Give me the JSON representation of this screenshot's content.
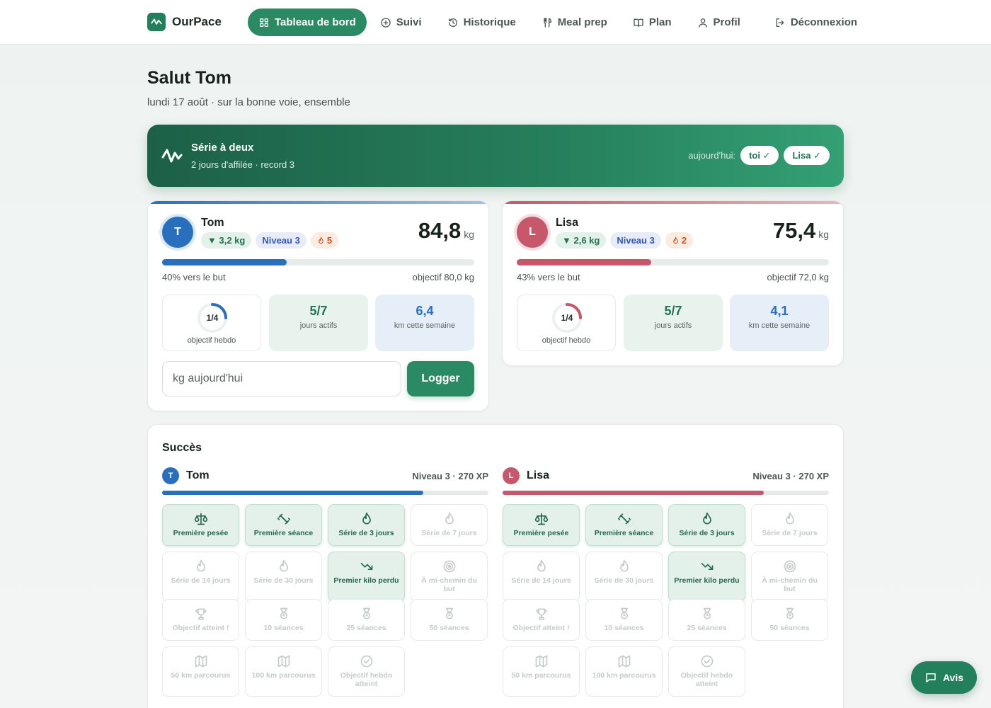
{
  "brand": {
    "name": "OurPace"
  },
  "nav": [
    {
      "label": "Tableau de bord",
      "icon": "grid-icon",
      "active": true
    },
    {
      "label": "Suivi",
      "icon": "plus-circle-icon"
    },
    {
      "label": "Historique",
      "icon": "history-icon"
    },
    {
      "label": "Meal prep",
      "icon": "utensils-icon"
    },
    {
      "label": "Plan",
      "icon": "book-icon"
    },
    {
      "label": "Profil",
      "icon": "user-icon"
    },
    {
      "label": "Déconnexion",
      "icon": "logout-icon"
    }
  ],
  "greeting": {
    "title": "Salut Tom",
    "subtitle": "lundi 17 août · sur la bonne voie, ensemble"
  },
  "streak": {
    "title": "Série à deux",
    "subtitle": "2 jours d'affilée · record 3",
    "today_label": "aujourd'hui:",
    "you": "toi ✓",
    "partner": "Lisa ✓"
  },
  "people": [
    {
      "initial": "T",
      "name": "Tom",
      "color": "#2870be",
      "loss": "▼ 3,2 kg",
      "level": "Niveau 3",
      "streak": "5",
      "weight": "84,8",
      "unit": "kg",
      "progress_pct": 40,
      "progress_label": "40% vers le but",
      "goal_label": "objectif 80,0 kg",
      "weekly_goal": "1/4",
      "weekly_goal_done": 1,
      "weekly_goal_total": 4,
      "weekly_goal_label": "objectif hebdo",
      "active_days": "5/7",
      "active_days_label": "jours actifs",
      "km": "6,4",
      "km_label": "km cette semaine",
      "level_line": "Niveau 3 · 270 XP",
      "xp_pct": 80
    },
    {
      "initial": "L",
      "name": "Lisa",
      "color": "#c7576a",
      "loss": "▼ 2,6 kg",
      "level": "Niveau 3",
      "streak": "2",
      "weight": "75,4",
      "unit": "kg",
      "progress_pct": 43,
      "progress_label": "43% vers le but",
      "goal_label": "objectif 72,0 kg",
      "weekly_goal": "1/4",
      "weekly_goal_done": 1,
      "weekly_goal_total": 4,
      "weekly_goal_label": "objectif hebdo",
      "active_days": "5/7",
      "active_days_label": "jours actifs",
      "km": "4,1",
      "km_label": "km cette semaine",
      "level_line": "Niveau 3 · 270 XP",
      "xp_pct": 80
    }
  ],
  "log": {
    "placeholder": "kg aujourd'hui",
    "button": "Logger"
  },
  "achievements": {
    "title": "Succès",
    "badges": [
      {
        "label": "Première pesée",
        "icon": "scale-icon",
        "unlocked": true
      },
      {
        "label": "Première séance",
        "icon": "dumbbell-icon",
        "unlocked": true
      },
      {
        "label": "Série de 3 jours",
        "icon": "flame-icon",
        "unlocked": true
      },
      {
        "label": "Série de 7 jours",
        "icon": "flame-icon",
        "unlocked": false
      },
      {
        "label": "Série de 14 jours",
        "icon": "flame-icon",
        "unlocked": false
      },
      {
        "label": "Série de 30 jours",
        "icon": "flame-icon",
        "unlocked": false
      },
      {
        "label": "Premier kilo perdu",
        "icon": "trend-down-icon",
        "unlocked": true
      },
      {
        "label": "À mi-chemin du but",
        "icon": "target-icon",
        "unlocked": false
      },
      {
        "label": "Objectif atteint !",
        "icon": "trophy-icon",
        "unlocked": false
      },
      {
        "label": "10 séances",
        "icon": "medal-icon",
        "unlocked": false
      },
      {
        "label": "25 séances",
        "icon": "medal-icon",
        "unlocked": false
      },
      {
        "label": "50 séances",
        "icon": "medal-icon",
        "unlocked": false
      },
      {
        "label": "50 km parcourus",
        "icon": "map-icon",
        "unlocked": false
      },
      {
        "label": "100 km parcourus",
        "icon": "map-icon",
        "unlocked": false
      },
      {
        "label": "Objectif hebdo atteint",
        "icon": "check-circle-icon",
        "unlocked": false
      }
    ]
  },
  "feedback": {
    "label": "Avis"
  },
  "colors": {
    "primary": "#2a8a64",
    "tom": "#2870be",
    "lisa": "#c7576a"
  }
}
